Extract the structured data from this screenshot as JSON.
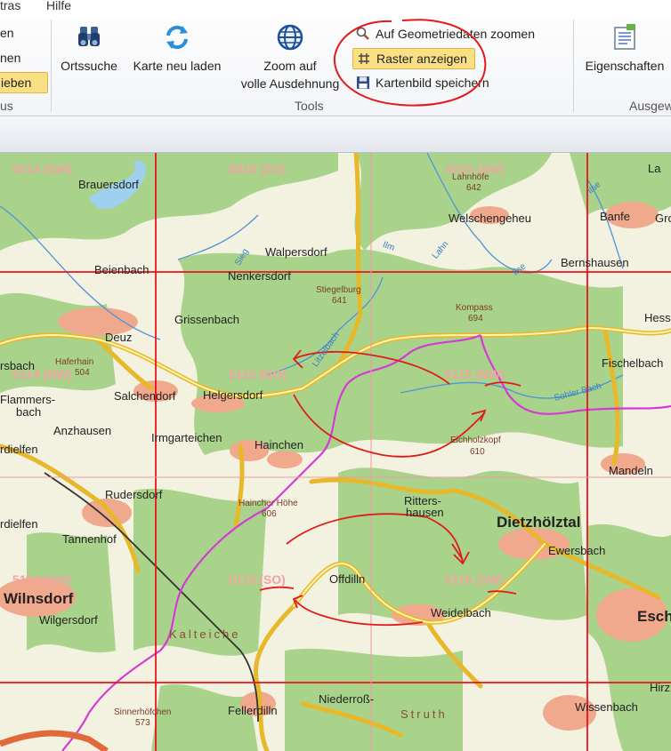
{
  "menu": {
    "left": "tras",
    "help": "Hilfe"
  },
  "ribbon": {
    "left_items": [
      "en",
      "nen",
      "ieben"
    ],
    "left_group_label": "us",
    "ortssuche": "Ortssuche",
    "neu_laden": "Karte neu laden",
    "zoom_line1": "Zoom auf",
    "zoom_line2": "volle Ausdehnung",
    "geom_zoom": "Auf Geometriedaten zoomen",
    "raster": "Raster anzeigen",
    "save_image": "Kartenbild speichern",
    "tools_label": "Tools",
    "properties": "Eigenschaften",
    "right_group_label": "Ausgew"
  },
  "map": {
    "sheets": [
      "5014 (SW)",
      "5015 (SO)",
      "5015 (SW)",
      "5114 (NW)",
      "5115 (NO)",
      "5115 (NW)",
      "5114 (SW)",
      "5115 (SO)",
      "5115 (SW)"
    ],
    "places": [
      "Brauersdorf",
      "Walpersdorf",
      "Welschengeheu",
      "Banfe",
      "Grol",
      "La",
      "Beienbach",
      "Nenkersdorf",
      "Bernshausen",
      "Grissenbach",
      "Deuz",
      "Hess",
      "Fischelbach",
      "Salchendorf",
      "Helgersdorf",
      "Flammers-",
      "bach",
      "Anzhausen",
      "Irmgarteichen",
      "Hainchen",
      "rdielfen",
      "Mandeln",
      "Rudersdorf",
      "Ritters-",
      "hausen",
      "Tannenhof",
      "Ewersbach",
      "Offdilln",
      "Weidelbach",
      "Wilgersdorf",
      "Fellerdilln",
      "Niederroß-",
      "Wissenbach",
      "rsbach",
      "rdielfen",
      "Hirz"
    ],
    "big_places": [
      "Wilnsdorf",
      "Dietzhölztal",
      "Esch"
    ],
    "peaks": [
      "Lahnhöfe",
      "642",
      "Stiegelburg",
      "641",
      "Kompass",
      "694",
      "Haferhain",
      "504",
      "Eichholzkopf",
      "610",
      "Haincher Höhe",
      "606",
      "Sinnerhöfchen",
      "573"
    ],
    "waters": [
      "Ilm",
      "Lahn",
      "Sieg",
      "Litzelbach",
      "Sohler Bach",
      "Ilse",
      "Ilse"
    ],
    "areas": [
      "Kalteiche",
      "Struth"
    ],
    "colors": {
      "grid": "#e8141c",
      "annotation": "#e01b1b",
      "border": "#d63ad6",
      "road": "#f4d23a",
      "forest": "#a9d38a",
      "open": "#f3f1df",
      "town": "#f1a98d",
      "water": "#9fd0ee"
    }
  }
}
